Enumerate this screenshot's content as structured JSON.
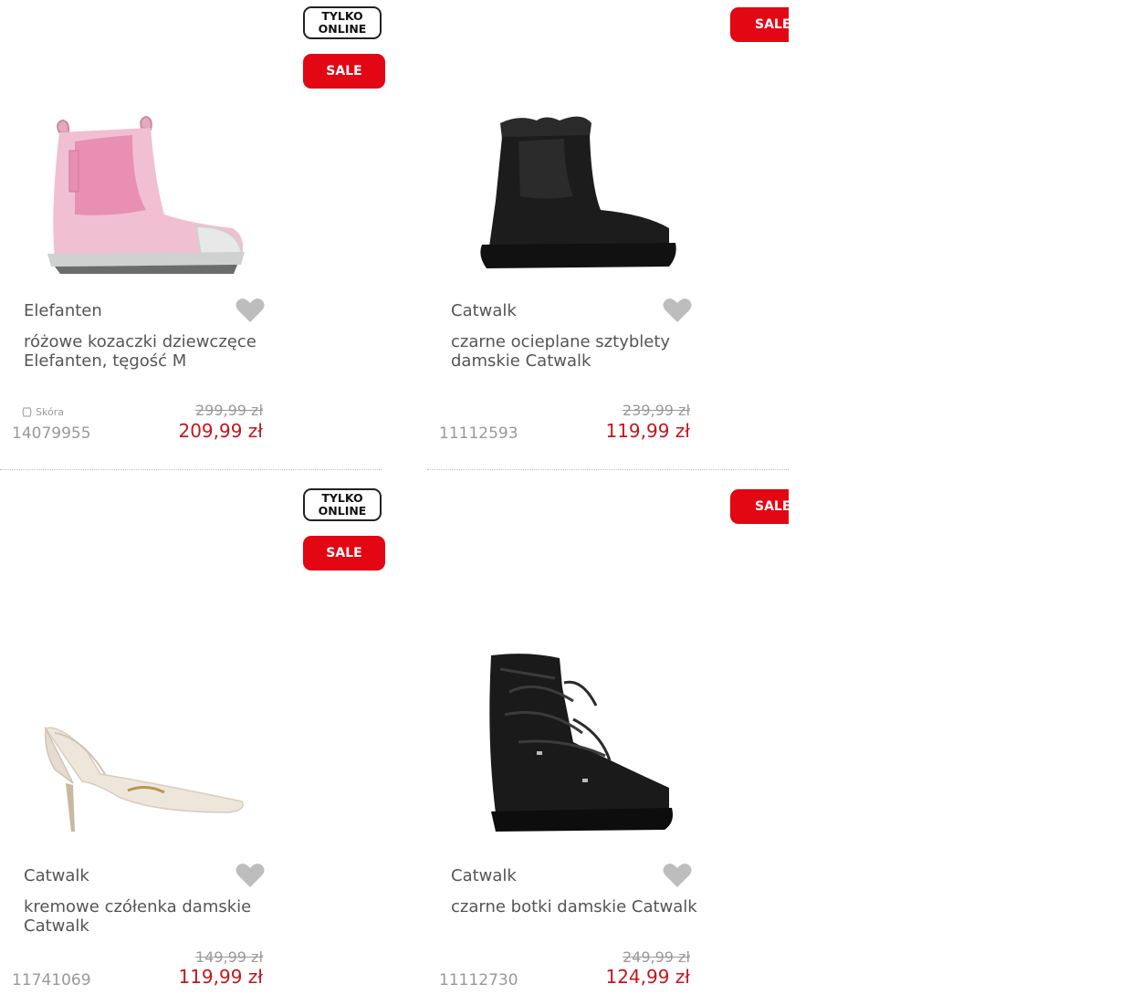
{
  "badges": {
    "online": "TYLKO ONLINE",
    "sale": "SALE"
  },
  "colors": {
    "sale_red": "#e30613",
    "price_red": "#c4161c",
    "heart_grey": "#bdbdbd"
  },
  "products": [
    {
      "brand": "Elefanten",
      "title": "różowe kozaczki dziewczęce Elefanten, tęgość M",
      "material": "Skóra",
      "sku": "14079955",
      "old_price": "299,99 zł",
      "new_price": "209,99 zł",
      "online_only": true,
      "image": "pink-chelsea-boot"
    },
    {
      "brand": "Catwalk",
      "title": "czarne ocieplane sztyblety damskie Catwalk",
      "sku": "11112593",
      "old_price": "239,99 zł",
      "new_price": "119,99 zł",
      "online_only": false,
      "image": "black-platform-chelsea-boot"
    },
    {
      "brand": "Catwalk",
      "title": "kremowe czółenka damskie Catwalk",
      "sku": "11741069",
      "old_price": "149,99 zł",
      "new_price": "119,99 zł",
      "online_only": true,
      "image": "cream-slingback-heel"
    },
    {
      "brand": "Catwalk",
      "title": "czarne botki damskie Catwalk",
      "sku": "11112730",
      "old_price": "249,99 zł",
      "new_price": "124,99 zł",
      "online_only": false,
      "image": "black-lace-up-boot"
    }
  ]
}
